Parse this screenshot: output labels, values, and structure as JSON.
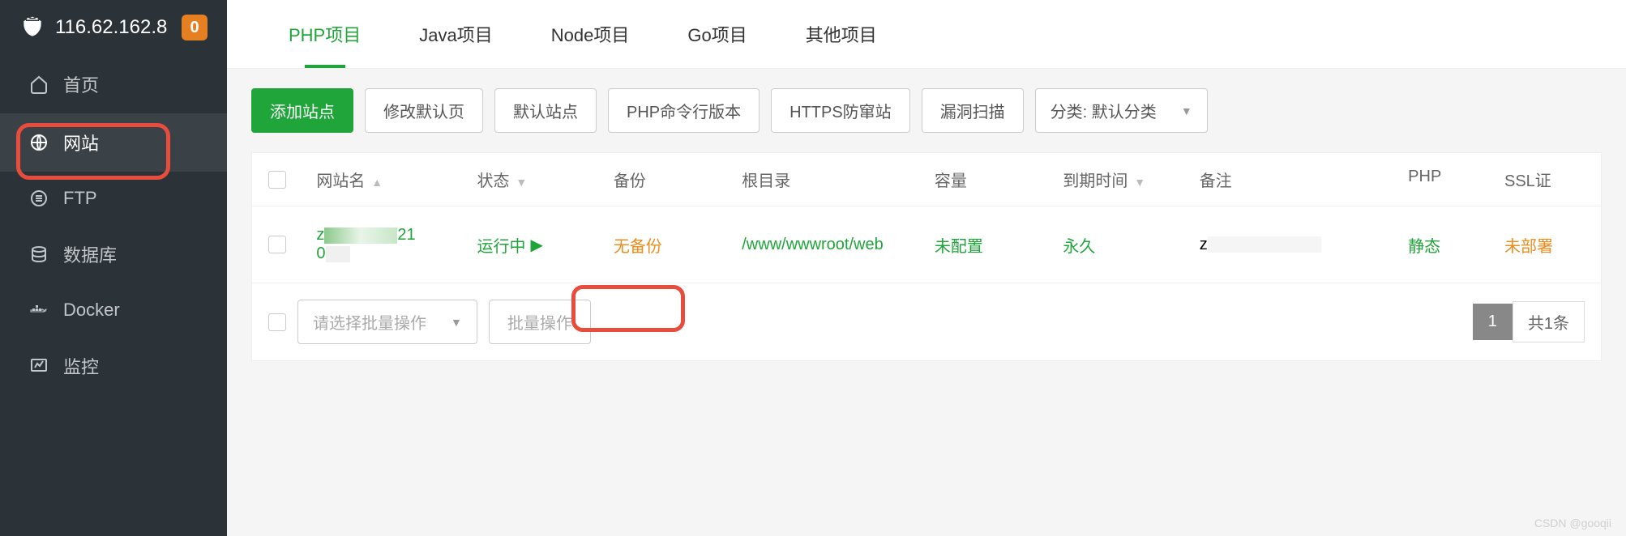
{
  "header": {
    "ip": "116.62.162.8",
    "badge": "0"
  },
  "sidebar": {
    "items": [
      {
        "label": "首页",
        "icon": "home"
      },
      {
        "label": "网站",
        "icon": "globe",
        "active": true
      },
      {
        "label": "FTP",
        "icon": "ftp"
      },
      {
        "label": "数据库",
        "icon": "database"
      },
      {
        "label": "Docker",
        "icon": "docker"
      },
      {
        "label": "监控",
        "icon": "monitor"
      }
    ]
  },
  "tabs": [
    {
      "label": "PHP项目",
      "active": true
    },
    {
      "label": "Java项目"
    },
    {
      "label": "Node项目"
    },
    {
      "label": "Go项目"
    },
    {
      "label": "其他项目"
    }
  ],
  "toolbar": {
    "add": "添加站点",
    "modify": "修改默认页",
    "default_site": "默认站点",
    "php_cli": "PHP命令行版本",
    "https": "HTTPS防窜站",
    "vuln": "漏洞扫描",
    "category": "分类: 默认分类"
  },
  "columns": {
    "name": "网站名",
    "status": "状态",
    "backup": "备份",
    "root": "根目录",
    "capacity": "容量",
    "expire": "到期时间",
    "note": "备注",
    "php": "PHP",
    "ssl": "SSL证"
  },
  "row": {
    "name_prefix": "z",
    "name_suffix_top": "21",
    "name_suffix_bot": "0",
    "status": "运行中",
    "backup": "无备份",
    "root": "/www/wwwroot/web",
    "capacity": "未配置",
    "expire": "永久",
    "note_prefix": "z",
    "php": "静态",
    "ssl": "未部署"
  },
  "footer": {
    "batch_placeholder": "请选择批量操作",
    "batch_button": "批量操作",
    "page": "1",
    "total": "共1条"
  },
  "watermark": "CSDN @gooqii"
}
